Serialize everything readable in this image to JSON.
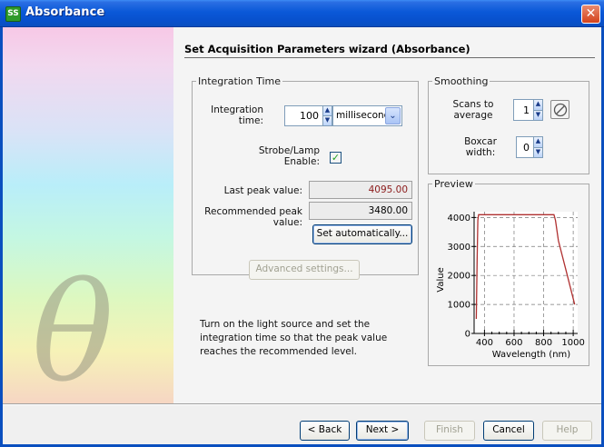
{
  "window": {
    "title": "Absorbance",
    "icon": "app-icon",
    "icon_text": "SS"
  },
  "wizard": {
    "title": "Set Acquisition Parameters wizard (Absorbance)"
  },
  "integration": {
    "group_label": "Integration Time",
    "time_label_line1": "Integration",
    "time_label_line2": "time:",
    "time_value": "100",
    "time_unit": "milliseconds",
    "strobe_label_line1": "Strobe/Lamp",
    "strobe_label_line2": "Enable:",
    "strobe_checked": true,
    "last_peak_label": "Last peak value:",
    "last_peak_value": "4095.00",
    "last_peak_color": "#8b1a1a",
    "recommended_label": "Recommended peak value:",
    "recommended_value": "3480.00",
    "set_auto_label": "Set automatically..."
  },
  "advanced_button": "Advanced settings...",
  "hint_text": "Turn on the light source and set the integration time so that the peak value reaches the recommended level.",
  "smoothing": {
    "group_label": "Smoothing",
    "scans_label_line1": "Scans to",
    "scans_label_line2": "average",
    "scans_value": "1",
    "boxcar_label_line1": "Boxcar",
    "boxcar_label_line2": "width:",
    "boxcar_value": "0",
    "reset_icon": "no-entry-icon"
  },
  "preview": {
    "group_label": "Preview"
  },
  "chart_data": {
    "type": "line",
    "xlabel": "Wavelength (nm)",
    "ylabel": "Value",
    "xlim": [
      330,
      1030
    ],
    "ylim": [
      0,
      4200
    ],
    "xticks": [
      400,
      600,
      800,
      1000
    ],
    "yticks": [
      0,
      1000,
      2000,
      3000,
      4000
    ],
    "grid": true,
    "line_color": "#b03030",
    "series": [
      {
        "x": [
          345,
          350,
          355,
          360,
          370,
          380,
          400,
          500,
          600,
          700,
          800,
          860,
          870,
          880,
          900,
          950,
          1000,
          1010
        ],
        "y": [
          500,
          2500,
          3900,
          4095,
          4095,
          4095,
          4095,
          4095,
          4095,
          4095,
          4095,
          4095,
          4095,
          3900,
          3200,
          2200,
          1200,
          1000
        ]
      }
    ]
  },
  "footer": {
    "back_label": "< Back",
    "next_label": "Next >",
    "finish_label": "Finish",
    "cancel_label": "Cancel",
    "help_label": "Help"
  }
}
